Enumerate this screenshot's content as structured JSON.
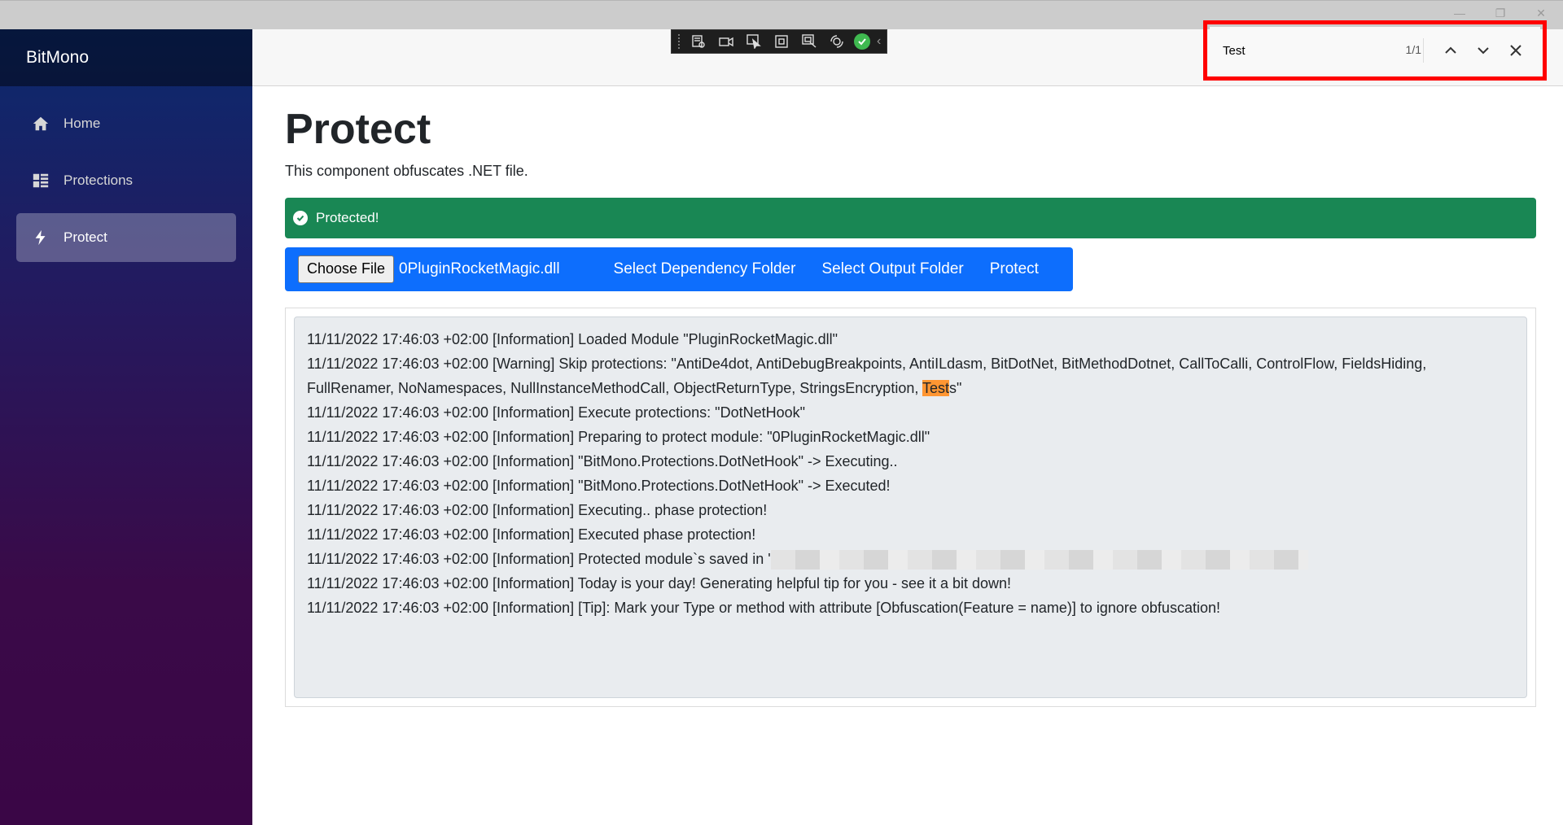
{
  "window": {
    "min_glyph": "—",
    "max_glyph": "❐",
    "close_glyph": "✕"
  },
  "sidebar": {
    "brand": "BitMono",
    "items": [
      {
        "label": "Home",
        "icon": "home-icon",
        "active": false
      },
      {
        "label": "Protections",
        "icon": "list-icon",
        "active": false
      },
      {
        "label": "Protect",
        "icon": "bolt-icon",
        "active": true
      }
    ]
  },
  "find": {
    "value": "Test",
    "count": "1/1"
  },
  "page": {
    "title": "Protect",
    "description": "This component obfuscates .NET file.",
    "alert": "Protected!",
    "choose_file": "Choose File",
    "file_name": "0PluginRocketMagic.dll",
    "select_dependency": "Select Dependency Folder",
    "select_output": "Select Output Folder",
    "protect": "Protect"
  },
  "log": {
    "lines": [
      "11/11/2022 17:46:03 +02:00 [Information] Loaded Module \"PluginRocketMagic.dll\"",
      "11/11/2022 17:46:03 +02:00 [Warning] Skip protections: \"AntiDe4dot, AntiDebugBreakpoints, AntiILdasm, BitDotNet, BitMethodDotnet, CallToCalli, ControlFlow, FieldsHiding, FullRenamer, NoNamespaces, NullInstanceMethodCall, ObjectReturnType, StringsEncryption, ",
      "Test",
      "s\"",
      "11/11/2022 17:46:03 +02:00 [Information] Execute protections: \"DotNetHook\"",
      "11/11/2022 17:46:03 +02:00 [Information] Preparing to protect module: \"0PluginRocketMagic.dll\"",
      "11/11/2022 17:46:03 +02:00 [Information] \"BitMono.Protections.DotNetHook\" -> Executing..",
      "11/11/2022 17:46:03 +02:00 [Information] \"BitMono.Protections.DotNetHook\" -> Executed!",
      "11/11/2022 17:46:03 +02:00 [Information] Executing.. phase protection!",
      "11/11/2022 17:46:03 +02:00 [Information] Executed phase protection!",
      "11/11/2022 17:46:03 +02:00 [Information] Protected module`s saved in '",
      "11/11/2022 17:46:03 +02:00 [Information] Today is your day! Generating helpful tip for you - see it a bit down!",
      "11/11/2022 17:46:03 +02:00 [Information] [Tip]: Mark your Type or method with attribute [Obfuscation(Feature = name)] to ignore obfuscation!"
    ]
  }
}
